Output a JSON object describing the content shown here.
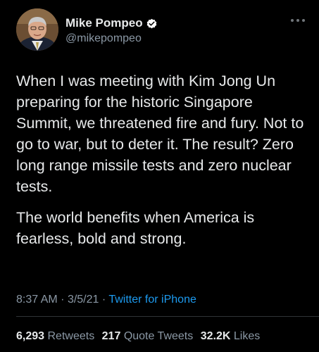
{
  "colors": {
    "background": "#000000",
    "text_primary": "#e7e9ea",
    "text_secondary": "#8b98a5",
    "link": "#1d9bf0",
    "verified_badge": "#ffffff"
  },
  "author": {
    "display_name": "Mike Pompeo",
    "handle": "@mikepompeo",
    "verified_icon": "verified-badge-icon",
    "more_icon": "more-horizontal-icon"
  },
  "tweet": {
    "paragraphs": [
      "When I was meeting with Kim Jong Un preparing for the historic Singapore Summit, we threatened fire and fury. Not to go to war, but to deter it. The result? Zero long range missile tests and zero nuclear tests.",
      "The world benefits when America is fearless, bold and strong."
    ]
  },
  "meta": {
    "time": "8:37 AM",
    "separator": "·",
    "date": "3/5/21",
    "source": "Twitter for iPhone"
  },
  "stats": [
    {
      "count": "6,293",
      "label": "Retweets"
    },
    {
      "count": "217",
      "label": "Quote Tweets"
    },
    {
      "count": "32.2K",
      "label": "Likes"
    }
  ]
}
